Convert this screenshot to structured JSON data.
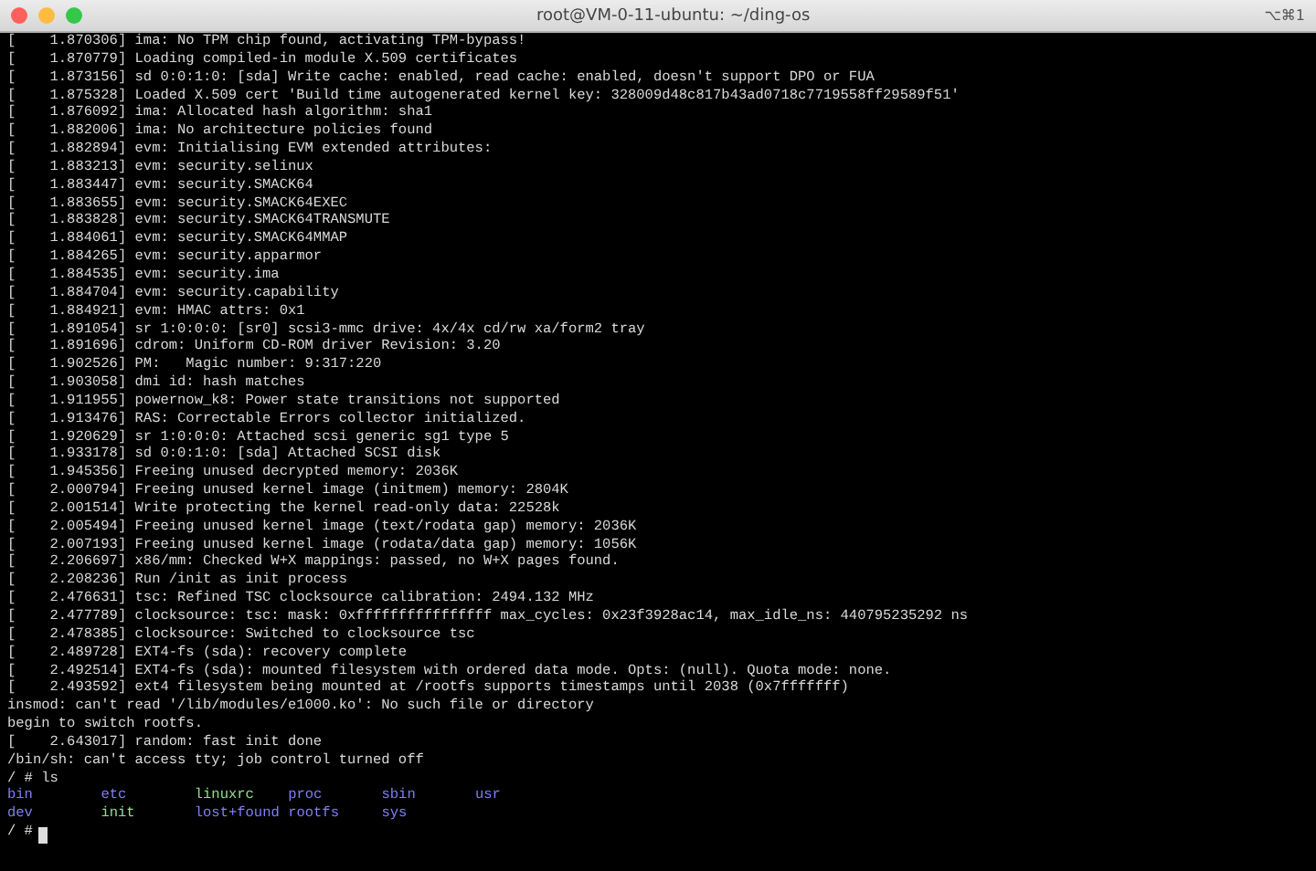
{
  "window": {
    "title": "root@VM-0-11-ubuntu: ~/ding-os",
    "shortcut": "⌥⌘1"
  },
  "terminal": {
    "lines": [
      "[    1.870306] ima: No TPM chip found, activating TPM-bypass!",
      "[    1.870779] Loading compiled-in module X.509 certificates",
      "[    1.873156] sd 0:0:1:0: [sda] Write cache: enabled, read cache: enabled, doesn't support DPO or FUA",
      "[    1.875328] Loaded X.509 cert 'Build time autogenerated kernel key: 328009d48c817b43ad0718c7719558ff29589f51'",
      "[    1.876092] ima: Allocated hash algorithm: sha1",
      "[    1.882006] ima: No architecture policies found",
      "[    1.882894] evm: Initialising EVM extended attributes:",
      "[    1.883213] evm: security.selinux",
      "[    1.883447] evm: security.SMACK64",
      "[    1.883655] evm: security.SMACK64EXEC",
      "[    1.883828] evm: security.SMACK64TRANSMUTE",
      "[    1.884061] evm: security.SMACK64MMAP",
      "[    1.884265] evm: security.apparmor",
      "[    1.884535] evm: security.ima",
      "[    1.884704] evm: security.capability",
      "[    1.884921] evm: HMAC attrs: 0x1",
      "[    1.891054] sr 1:0:0:0: [sr0] scsi3-mmc drive: 4x/4x cd/rw xa/form2 tray",
      "[    1.891696] cdrom: Uniform CD-ROM driver Revision: 3.20",
      "[    1.902526] PM:   Magic number: 9:317:220",
      "[    1.903058] dmi id: hash matches",
      "[    1.911955] powernow_k8: Power state transitions not supported",
      "[    1.913476] RAS: Correctable Errors collector initialized.",
      "[    1.920629] sr 1:0:0:0: Attached scsi generic sg1 type 5",
      "[    1.933178] sd 0:0:1:0: [sda] Attached SCSI disk",
      "[    1.945356] Freeing unused decrypted memory: 2036K",
      "[    2.000794] Freeing unused kernel image (initmem) memory: 2804K",
      "[    2.001514] Write protecting the kernel read-only data: 22528k",
      "[    2.005494] Freeing unused kernel image (text/rodata gap) memory: 2036K",
      "[    2.007193] Freeing unused kernel image (rodata/data gap) memory: 1056K",
      "[    2.206697] x86/mm: Checked W+X mappings: passed, no W+X pages found.",
      "[    2.208236] Run /init as init process",
      "[    2.476631] tsc: Refined TSC clocksource calibration: 2494.132 MHz",
      "[    2.477789] clocksource: tsc: mask: 0xffffffffffffffff max_cycles: 0x23f3928ac14, max_idle_ns: 440795235292 ns",
      "[    2.478385] clocksource: Switched to clocksource tsc",
      "[    2.489728] EXT4-fs (sda): recovery complete",
      "[    2.492514] EXT4-fs (sda): mounted filesystem with ordered data mode. Opts: (null). Quota mode: none.",
      "[    2.493592] ext4 filesystem being mounted at /rootfs supports timestamps until 2038 (0x7fffffff)",
      "insmod: can't read '/lib/modules/e1000.ko': No such file or directory",
      "begin to switch rootfs.",
      "[    2.643017] random: fast init done",
      "/bin/sh: can't access tty; job control turned off",
      "/ # ls"
    ],
    "ls_entries": [
      {
        "name": "bin",
        "kind": "dir"
      },
      {
        "name": "etc",
        "kind": "dir"
      },
      {
        "name": "linuxrc",
        "kind": "exec"
      },
      {
        "name": "proc",
        "kind": "dir"
      },
      {
        "name": "sbin",
        "kind": "dir"
      },
      {
        "name": "usr",
        "kind": "dir"
      },
      {
        "name": "dev",
        "kind": "dir"
      },
      {
        "name": "init",
        "kind": "exec"
      },
      {
        "name": "lost+found",
        "kind": "dir"
      },
      {
        "name": "rootfs",
        "kind": "dir"
      },
      {
        "name": "sys",
        "kind": "dir"
      }
    ],
    "prompt": "/ #"
  }
}
